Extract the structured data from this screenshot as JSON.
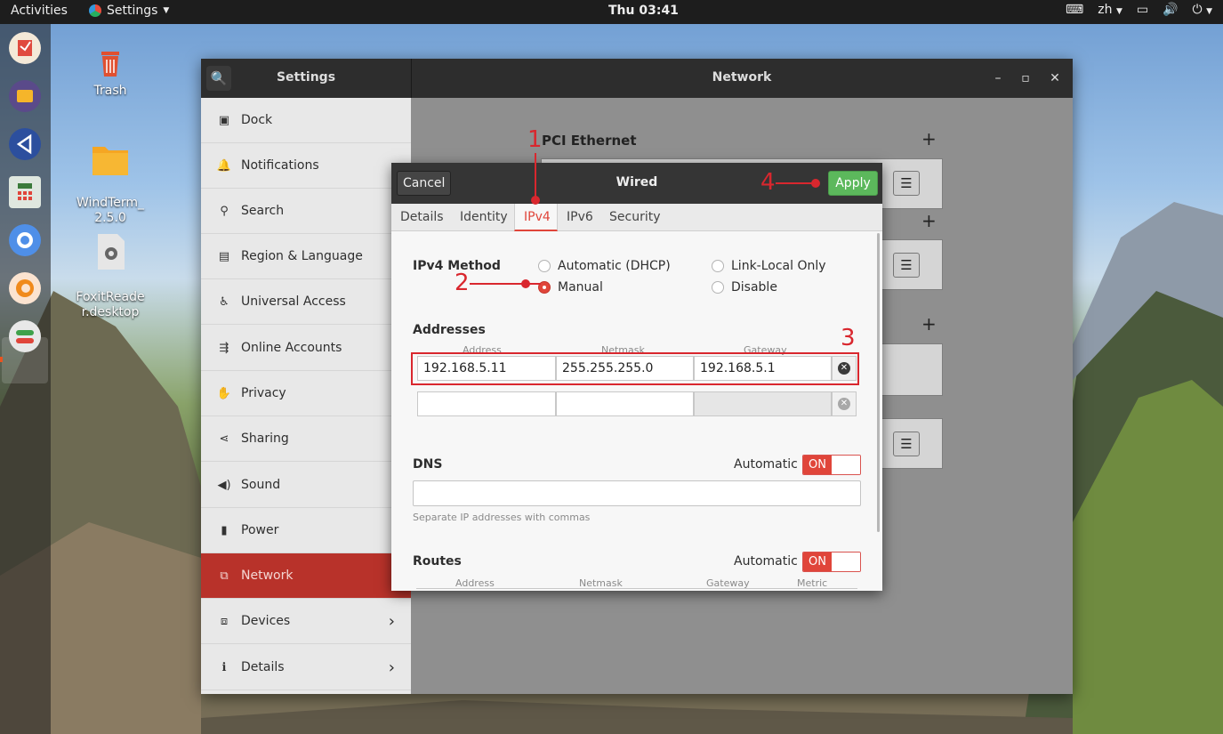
{
  "topbar": {
    "activities": "Activities",
    "app_name": "Settings",
    "clock": "Thu 03:41",
    "input_method": "zh"
  },
  "desktop": {
    "icons": [
      {
        "label": "Trash"
      },
      {
        "label": "WindTerm_\n2.5.0"
      },
      {
        "label": "FoxitReade\nr.desktop"
      }
    ]
  },
  "settings": {
    "sidebar_title": "Settings",
    "main_title": "Network",
    "sidebar_items": [
      {
        "label": "Dock",
        "icon": "dock-icon"
      },
      {
        "label": "Notifications",
        "icon": "bell-icon"
      },
      {
        "label": "Search",
        "icon": "search-icon"
      },
      {
        "label": "Region & Language",
        "icon": "camera-icon"
      },
      {
        "label": "Universal Access",
        "icon": "accessibility-icon"
      },
      {
        "label": "Online Accounts",
        "icon": "online-accounts-icon"
      },
      {
        "label": "Privacy",
        "icon": "hand-icon"
      },
      {
        "label": "Sharing",
        "icon": "share-icon"
      },
      {
        "label": "Sound",
        "icon": "speaker-icon"
      },
      {
        "label": "Power",
        "icon": "power-icon"
      },
      {
        "label": "Network",
        "icon": "network-icon"
      },
      {
        "label": "Devices",
        "icon": "devices-icon"
      },
      {
        "label": "Details",
        "icon": "info-icon"
      }
    ],
    "active_item": "Network",
    "pane": {
      "section_label": "PCI Ethernet"
    }
  },
  "dialog": {
    "title": "Wired",
    "cancel_label": "Cancel",
    "apply_label": "Apply",
    "tabs": [
      "Details",
      "Identity",
      "IPv4",
      "IPv6",
      "Security"
    ],
    "active_tab": "IPv4",
    "ipv4_method_label": "IPv4 Method",
    "methods": {
      "dhcp": "Automatic (DHCP)",
      "link_local": "Link-Local Only",
      "manual": "Manual",
      "disable": "Disable"
    },
    "selected_method": "Manual",
    "addresses_label": "Addresses",
    "address_headers": {
      "address": "Address",
      "netmask": "Netmask",
      "gateway": "Gateway"
    },
    "address_rows": [
      {
        "address": "192.168.5.11",
        "netmask": "255.255.255.0",
        "gateway": "192.168.5.1"
      }
    ],
    "dns_label": "DNS",
    "dns_automatic_label": "Automatic",
    "dns_toggle": "ON",
    "dns_hint": "Separate IP addresses with commas",
    "routes_label": "Routes",
    "routes_automatic_label": "Automatic",
    "routes_toggle": "ON",
    "route_headers": {
      "address": "Address",
      "netmask": "Netmask",
      "gateway": "Gateway",
      "metric": "Metric"
    }
  },
  "annotations": [
    "1",
    "2",
    "3",
    "4"
  ],
  "colors": {
    "accent": "#e0453a",
    "active_sidebar": "#b8322a",
    "apply": "#5cb85c",
    "annotation": "#d9272e"
  }
}
